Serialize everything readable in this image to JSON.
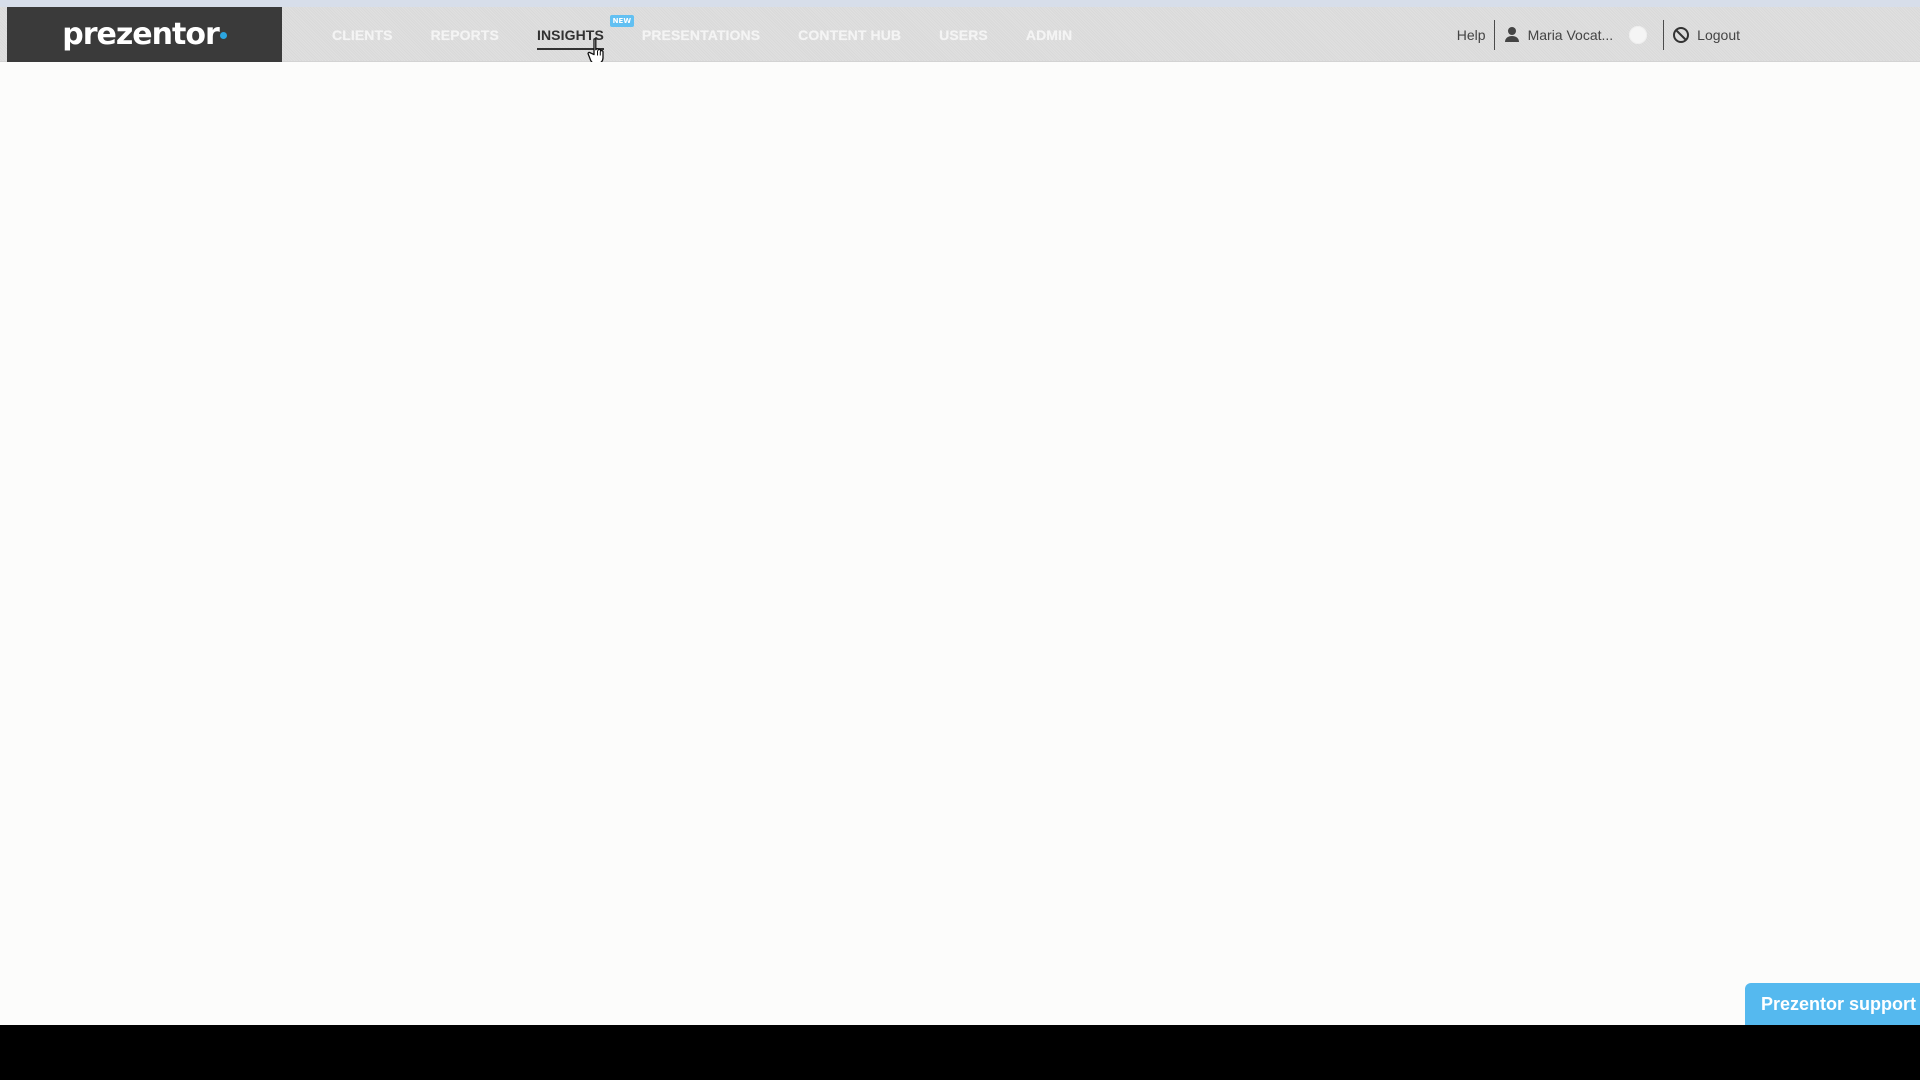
{
  "brand": {
    "logo_text": "prezentor",
    "logo_dot_color": "#2ca5e0"
  },
  "navigation": {
    "items": [
      {
        "label": "CLIENTS"
      },
      {
        "label": "REPORTS"
      },
      {
        "label": "INSIGHTS",
        "badge": "new",
        "active": true
      },
      {
        "label": "PRESENTATIONS"
      },
      {
        "label": "CONTENT HUB"
      },
      {
        "label": "USERS"
      },
      {
        "label": "ADMIN"
      }
    ]
  },
  "user_menu": {
    "help_label": "Help",
    "user_name": "Maria Vocat...",
    "logout_label": "Logout"
  },
  "support": {
    "label": "Prezentor support"
  },
  "colors": {
    "accent_blue": "#55b9ef",
    "badge_blue": "#62c0f2",
    "header_gray": "#dddddd",
    "logo_background": "#3a3a3a"
  },
  "icons": {
    "user": "user-icon",
    "logout": "logout-icon",
    "cursor": "hand-pointer-icon"
  }
}
